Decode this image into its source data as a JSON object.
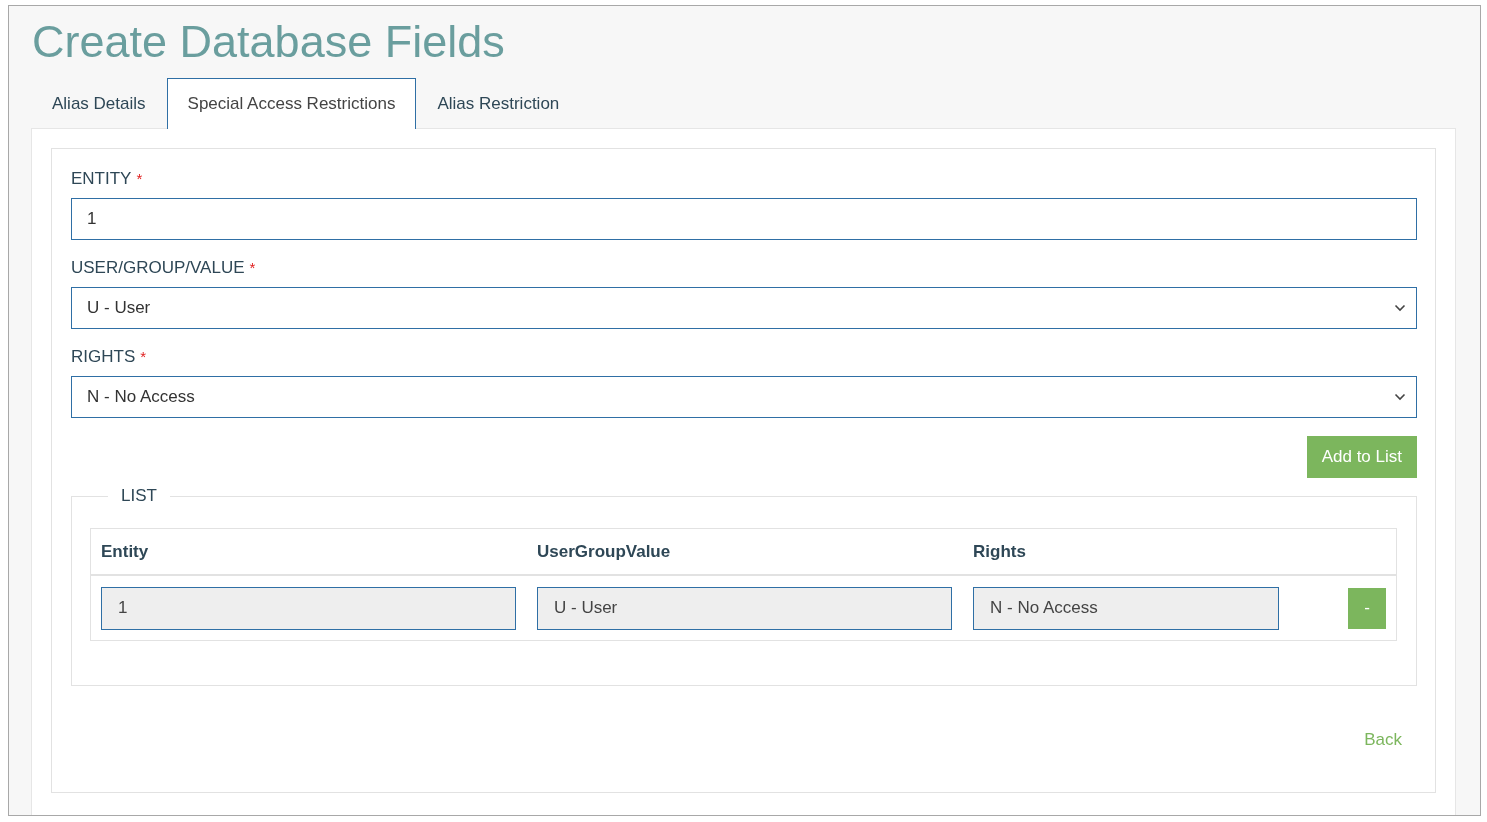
{
  "title": "Create Database Fields",
  "tabs": [
    {
      "label": "Alias Details",
      "selected": false
    },
    {
      "label": "Special Access Restrictions",
      "selected": true
    },
    {
      "label": "Alias Restriction",
      "selected": false
    }
  ],
  "fields": [
    {
      "label": "ENTITY",
      "required_mark": "*",
      "kind": "text",
      "value": "1"
    },
    {
      "label": "USER/GROUP/VALUE",
      "required_mark": "*",
      "kind": "select",
      "value": "U - User"
    },
    {
      "label": "RIGHTS",
      "required_mark": "*",
      "kind": "select",
      "value": "N - No Access"
    }
  ],
  "add_button": "Add to List",
  "list": {
    "legend": "LIST",
    "columns": [
      "Entity",
      "UserGroupValue",
      "Rights"
    ],
    "rows": [
      {
        "cells": [
          "1",
          "U - User",
          "N - No Access"
        ],
        "remove_label": "-"
      }
    ]
  },
  "back_link": "Back"
}
